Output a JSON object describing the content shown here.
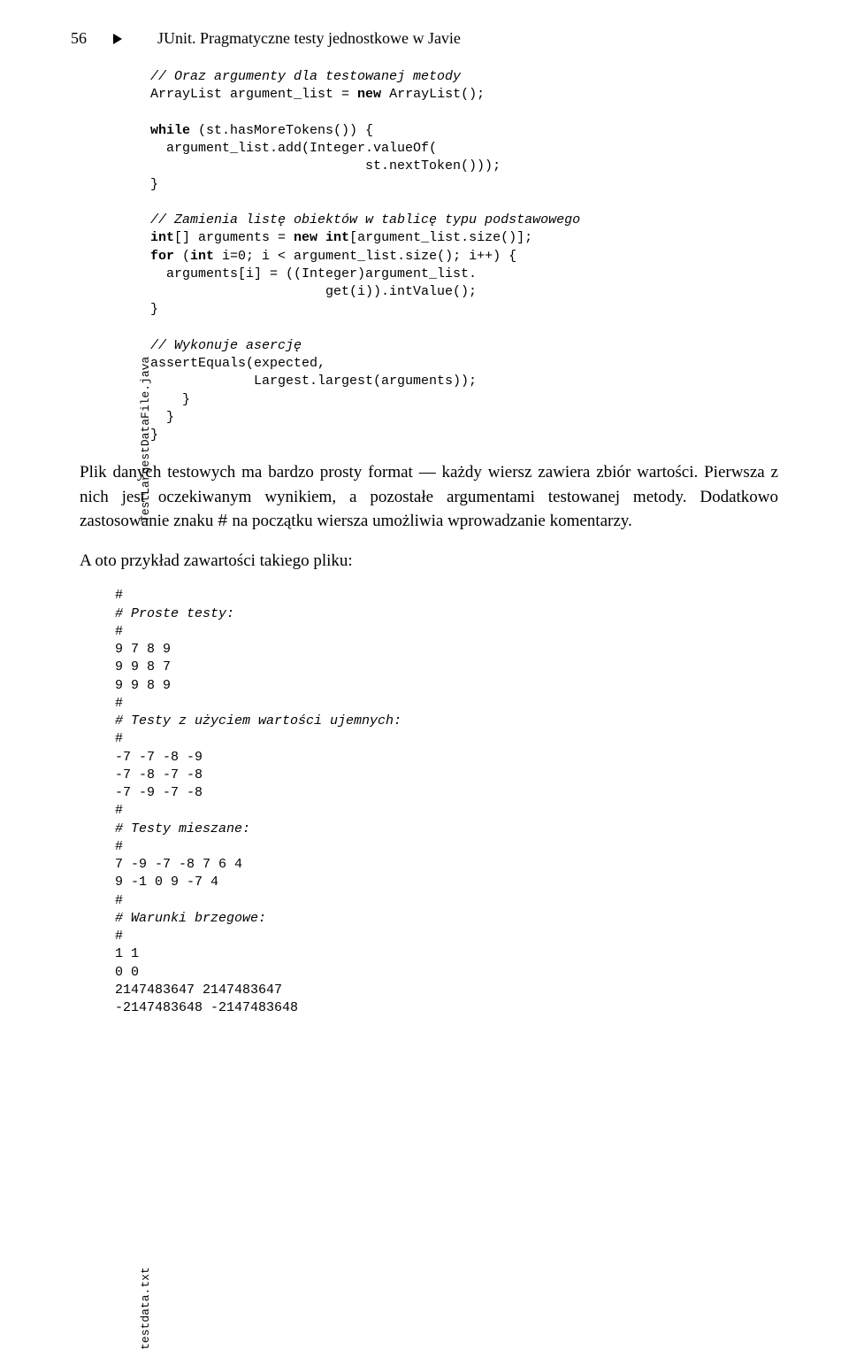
{
  "header": {
    "page_number": "56",
    "title": "JUnit. Pragmatyczne testy jednostkowe w Javie"
  },
  "sidebar_label_1": "TestLargestDataFile.java",
  "sidebar_label_2": "testdata.txt",
  "code1": {
    "c1": "// Oraz argumenty dla testowanej metody",
    "l1": "ArrayList argument_list = ",
    "k1": "new",
    "l1b": " ArrayList();",
    "k2": "while",
    "l2": " (st.hasMoreTokens()) {",
    "l3": "  argument_list.add(Integer.valueOf(",
    "l4": "                           st.nextToken()));",
    "l5": "}",
    "c2": "// Zamienia listę obiektów w tablicę typu podstawowego",
    "k3": "int",
    "l6a": "[] arguments = ",
    "k4": "new int",
    "l6b": "[argument_list.size()];",
    "k5": "for",
    "l7a": " (",
    "k6": "int",
    "l7b": " i=0; i < argument_list.size(); i++) {",
    "l8": "  arguments[i] = ((Integer)argument_list.",
    "l9": "                      get(i)).intValue();",
    "l10": "}",
    "c3": "// Wykonuje asercję",
    "l11": "assertEquals(expected,",
    "l12": "             Largest.largest(arguments));",
    "l13": "    }",
    "l14": "  }",
    "l15": "}"
  },
  "para1": "Plik danych testowych ma bardzo prosty format — każdy wiersz zawiera zbiór wartości. Pierwsza z nich jest oczekiwanym wynikiem, a pozostałe argumentami testowanej metody. Dodatkowo zastosowanie znaku ",
  "para1_code": "#",
  "para1_end": " na początku wiersza umożliwia wprowadzanie komentarzy.",
  "para2": "A oto przykład zawartości takiego pliku:",
  "code2": {
    "l1": "#",
    "c1": "# Proste testy:",
    "l2": "#",
    "l3": "9 7 8 9",
    "l4": "9 9 8 7",
    "l5": "9 9 8 9",
    "l6": "#",
    "c2": "# Testy z użyciem wartości ujemnych:",
    "l7": "#",
    "l8": "-7 -7 -8 -9",
    "l9": "-7 -8 -7 -8",
    "l10": "-7 -9 -7 -8",
    "l11": "#",
    "c3": "# Testy mieszane:",
    "l12": "#",
    "l13": "7 -9 -7 -8 7 6 4",
    "l14": "9 -1 0 9 -7 4",
    "l15": "#",
    "c4": "# Warunki brzegowe:",
    "l16": "#",
    "l17": "1 1",
    "l18": "0 0",
    "l19": "2147483647 2147483647",
    "l20": "-2147483648 -2147483648"
  }
}
